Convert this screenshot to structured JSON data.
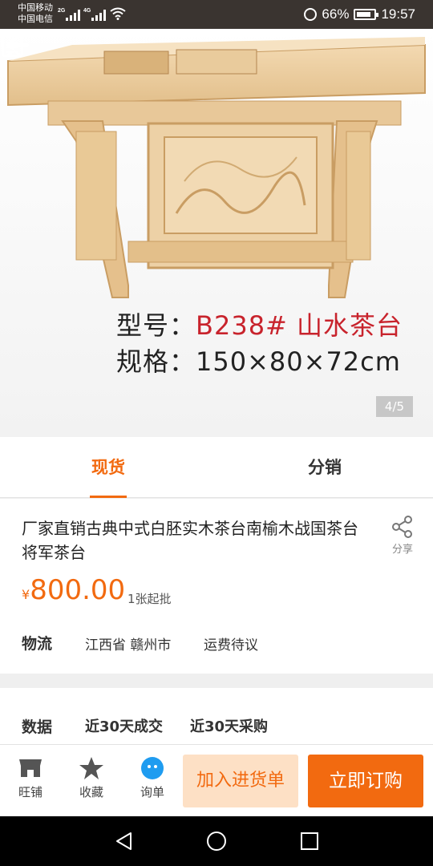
{
  "status_bar": {
    "carrier_1": "中国移动",
    "carrier_2": "中国电信",
    "net_1": "2G",
    "net_2": "4G",
    "battery": "66%",
    "time": "19:57"
  },
  "hero": {
    "model_label": "型号：",
    "model_value": "B238# 山水茶台",
    "spec_label": "规格：",
    "spec_value": "150×80×72cm",
    "pager": "4/5",
    "accent_red": "#c8232c"
  },
  "tabs": [
    {
      "label": "现货",
      "active": true
    },
    {
      "label": "分销",
      "active": false
    }
  ],
  "product": {
    "title": "厂家直销古典中式白胚实木茶台南榆木战国茶台将军茶台",
    "share_label": "分享",
    "currency": "¥",
    "price": "800.00",
    "moq": "1张起批",
    "logistics_label": "物流",
    "logistics_place": "江西省 赣州市",
    "logistics_fee": "运费待议"
  },
  "data_section": {
    "label": "数据",
    "item_1": "近30天成交",
    "item_2": "近30天采购"
  },
  "action_bar": {
    "shop": "旺铺",
    "favorite": "收藏",
    "inquiry": "询单",
    "add_cart": "加入进货单",
    "buy_now": "立即订购",
    "accent": "#f26a10",
    "accent_light": "#fde0c5"
  }
}
